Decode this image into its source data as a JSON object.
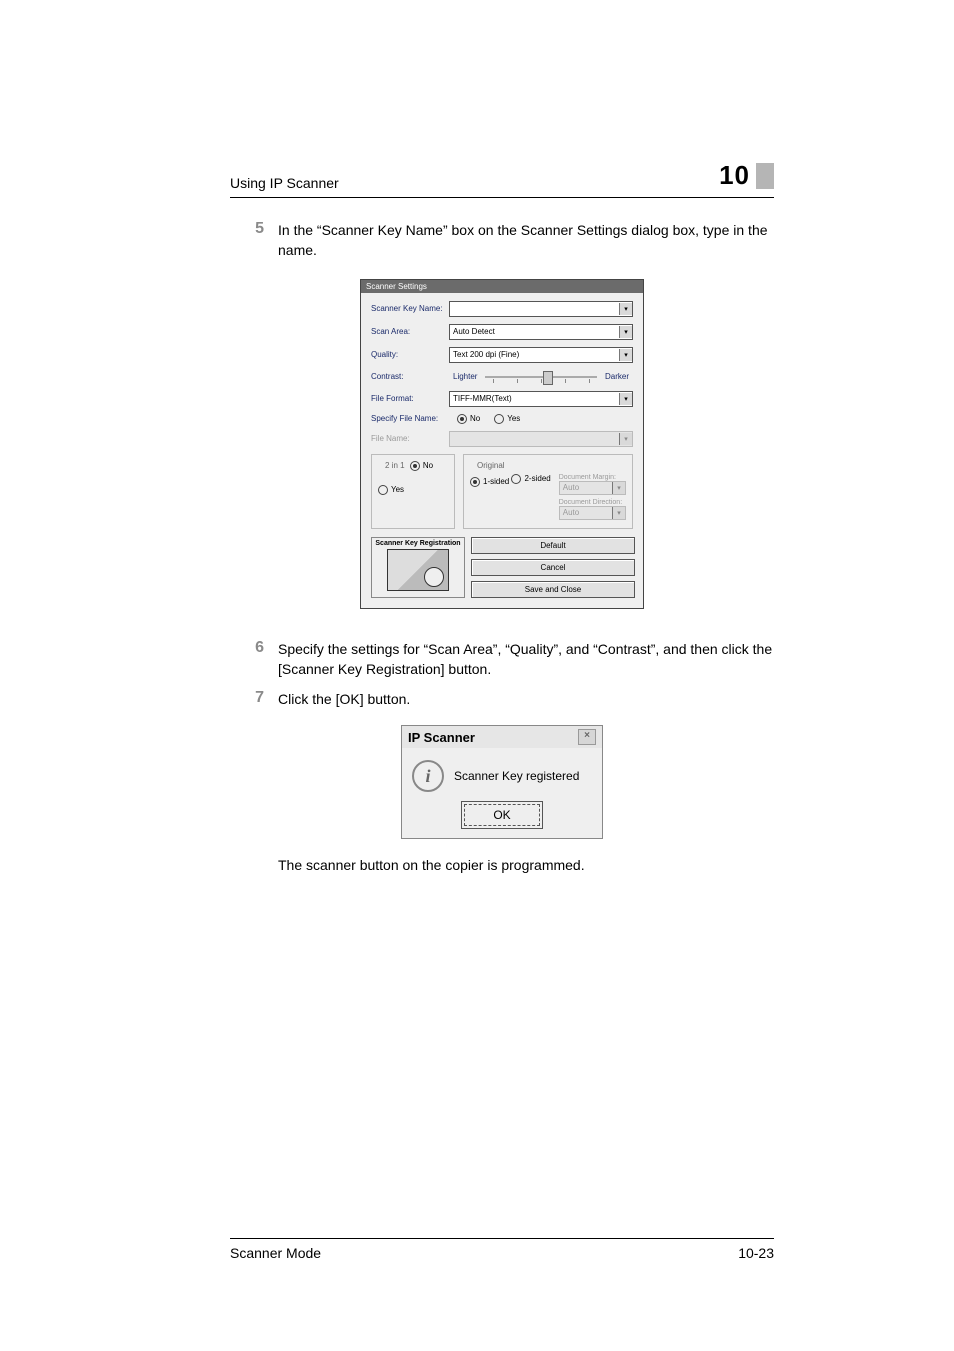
{
  "header": {
    "section_title": "Using IP Scanner",
    "chapter_number": "10"
  },
  "steps": {
    "s5": {
      "num": "5",
      "text": "In the “Scanner Key Name” box on the Scanner Settings dialog box, type in the name."
    },
    "s6": {
      "num": "6",
      "text": "Specify the settings for “Scan Area”, “Quality”, and “Contrast”, and then click the [Scanner Key Registration] button."
    },
    "s7": {
      "num": "7",
      "text": "Click the [OK] button."
    }
  },
  "dialog": {
    "title": "Scanner Settings",
    "scanner_key_name_label": "Scanner Key Name:",
    "scan_area_label": "Scan Area:",
    "scan_area_value": "Auto Detect",
    "quality_label": "Quality:",
    "quality_value": "Text 200 dpi (Fine)",
    "contrast_label": "Contrast:",
    "lighter": "Lighter",
    "darker": "Darker",
    "file_format_label": "File Format:",
    "file_format_value": "TIFF-MMR(Text)",
    "specify_file_name_label": "Specify File Name:",
    "no": "No",
    "yes": "Yes",
    "file_name_label": "File Name:",
    "two_in_one_legend": "2 in 1",
    "original_legend": "Original",
    "one_sided": "1-sided",
    "two_sided": "2-sided",
    "doc_margin_label": "Document Margin:",
    "doc_margin_value": "Auto",
    "doc_direction_label": "Document Direction:",
    "doc_direction_value": "Auto",
    "reg_box_title": "Scanner Key Registration",
    "btn_default": "Default",
    "btn_cancel": "Cancel",
    "btn_save_close": "Save and Close"
  },
  "confirm": {
    "title": "IP Scanner",
    "message": "Scanner Key registered",
    "ok": "OK"
  },
  "after_text": "The scanner button on the copier is programmed.",
  "footer": {
    "left": "Scanner Mode",
    "right": "10-23"
  }
}
